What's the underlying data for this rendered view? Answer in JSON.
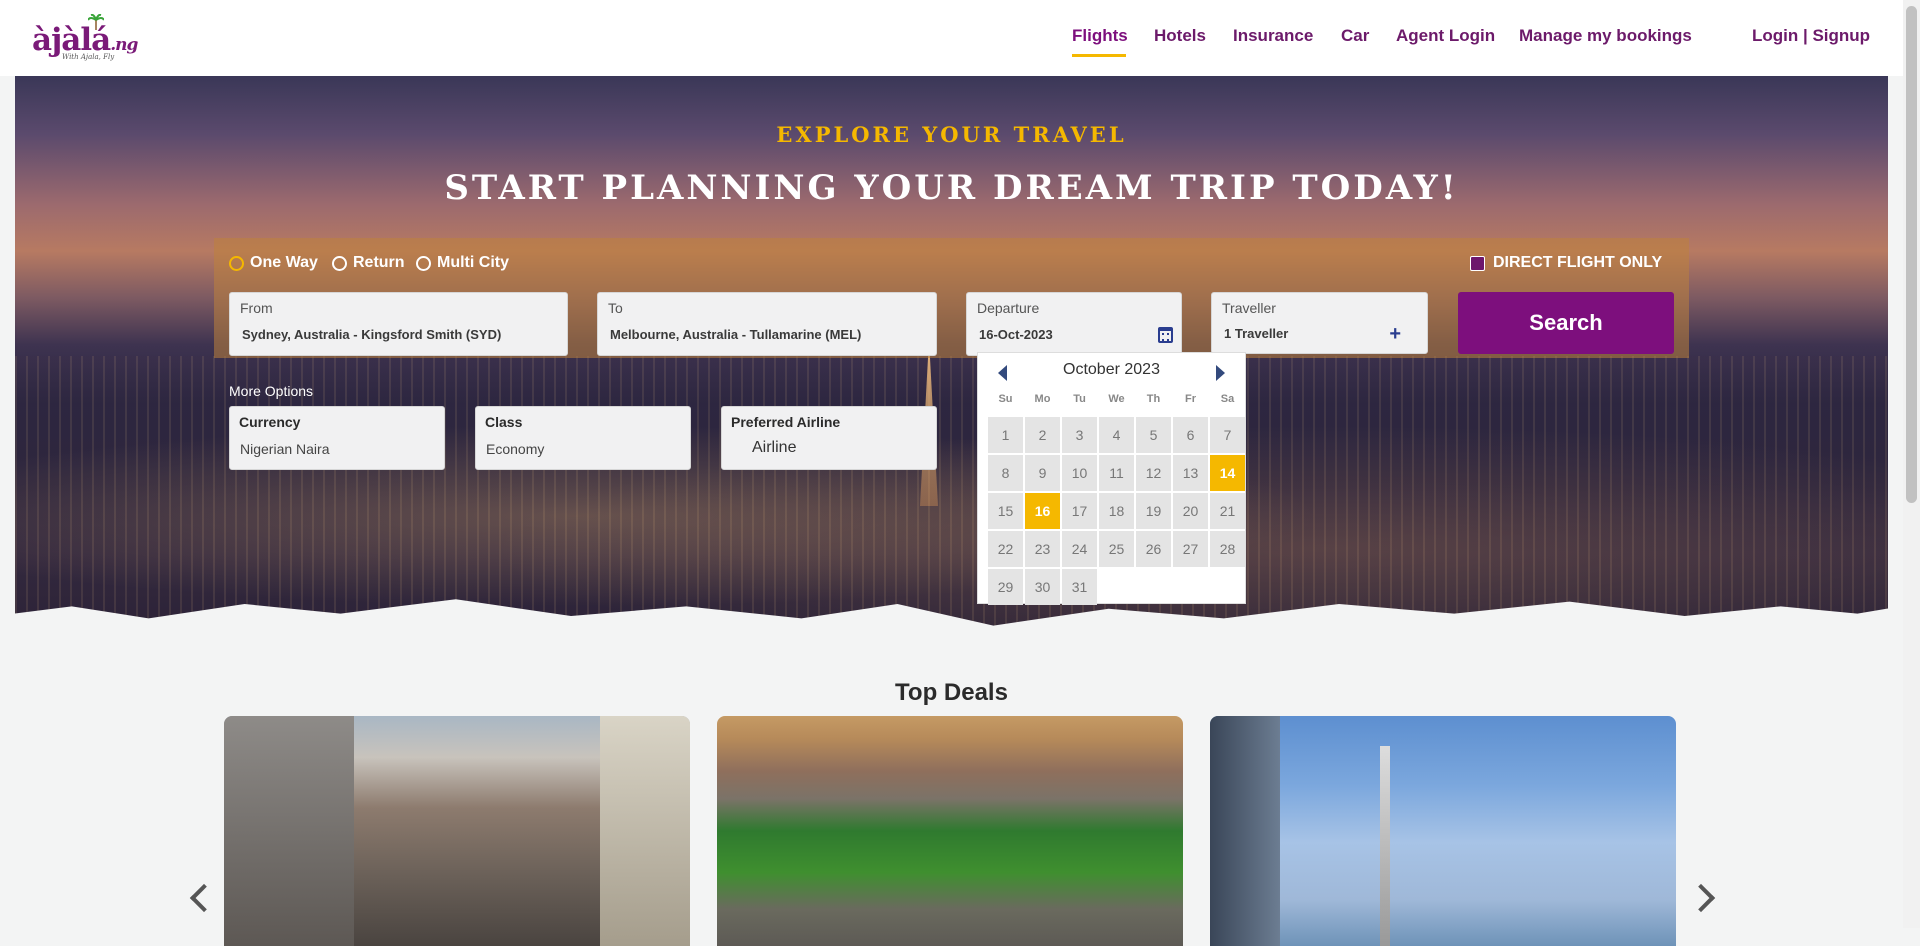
{
  "brand": {
    "logo_text": "àjàlá",
    "logo_suffix": ".ng",
    "tagline": "With Ajala, Fly"
  },
  "nav": {
    "flights": "Flights",
    "hotels": "Hotels",
    "insurance": "Insurance",
    "car": "Car",
    "agent_login": "Agent Login",
    "manage": "Manage my bookings",
    "login": "Login | Signup",
    "active": "Flights",
    "accent": "#f5b800"
  },
  "hero": {
    "kicker": "EXPLORE YOUR TRAVEL",
    "title": "START PLANNING YOUR DREAM TRIP TODAY!"
  },
  "search": {
    "trip_types": [
      "One Way",
      "Return",
      "Multi City"
    ],
    "selected_trip": "One Way",
    "direct_flight": "DIRECT FLIGHT ONLY",
    "from_label": "From",
    "from_value": "Sydney, Australia - Kingsford Smith (SYD)",
    "to_label": "To",
    "to_value": "Melbourne, Australia - Tullamarine (MEL)",
    "departure_label": "Departure",
    "departure_value": "16-Oct-2023",
    "traveller_label": "Traveller",
    "traveller_value": "1 Traveller",
    "search_button": "Search",
    "more_options": "More Options",
    "currency_label": "Currency",
    "currency_value": "Nigerian Naira",
    "class_label": "Class",
    "class_value": "Economy",
    "airline_label": "Preferred Airline",
    "airline_value": "Airline",
    "brand_color": "#7d0f7d"
  },
  "calendar": {
    "month": "October 2023",
    "weekdays": [
      "Su",
      "Mo",
      "Tu",
      "We",
      "Th",
      "Fr",
      "Sa"
    ],
    "days": [
      1,
      2,
      3,
      4,
      5,
      6,
      7,
      8,
      9,
      10,
      11,
      12,
      13,
      14,
      15,
      16,
      17,
      18,
      19,
      20,
      21,
      22,
      23,
      24,
      25,
      26,
      27,
      28,
      29,
      30,
      31
    ],
    "first_weekday": 0,
    "highlighted": [
      14,
      16
    ]
  },
  "deals": {
    "title": "Top Deals"
  }
}
